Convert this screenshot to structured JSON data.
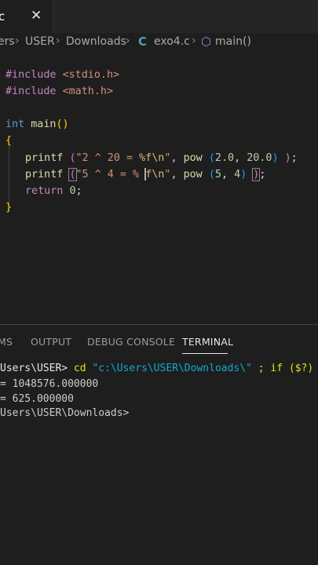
{
  "tab": {
    "label": "c",
    "close": "✕"
  },
  "breadcrumb": {
    "items": [
      "ers",
      "USER",
      "Downloads",
      "exo4.c",
      "main()"
    ],
    "sep": "›"
  },
  "code": {
    "l1": {
      "directive": "#include",
      "header": "<stdio.h>"
    },
    "l2": {
      "directive": "#include",
      "header": "<math.h>"
    },
    "l4": {
      "type": "int",
      "name": "main",
      "parens": "()"
    },
    "l5": "{",
    "l6": {
      "fn": "printf",
      "space": " ",
      "open": "(",
      "str1": "\"2 ^ 20 = ",
      "fmt": "%f",
      "esc": "\\n",
      "str2": "\"",
      "comma": ", ",
      "call": "pow",
      "sp2": " ",
      "open2": "(",
      "a": "2.0",
      "c2": ", ",
      "b": "20.0",
      "close2": ")",
      "sp3": " ",
      "close": ")",
      "semi": ";"
    },
    "l7": {
      "fn": "printf",
      "space": " ",
      "open": "(",
      "str1": "\"5 ^ 4 = % ",
      "fmt": "f",
      "esc": "\\n",
      "str2": "\"",
      "comma": ", ",
      "call": "pow",
      "sp2": " ",
      "open2": "(",
      "a": "5",
      "c2": ", ",
      "b": "4",
      "close2": ")",
      "sp3": " ",
      "close": ")",
      "semi": ";"
    },
    "l8": {
      "kw": "return",
      "val": "0",
      "semi": ";"
    },
    "l9": "}"
  },
  "panel": {
    "tabs": [
      "MS",
      "OUTPUT",
      "DEBUG CONSOLE",
      "TERMINAL"
    ],
    "active": "TERMINAL"
  },
  "terminal": {
    "line1": {
      "prompt": "Users\\USER> ",
      "cmd": "cd",
      "arg": " \"c:\\Users\\USER\\Downloads\\\"",
      "rest": " ; if ($?) {"
    },
    "line2": "= 1048576.000000",
    "line3": "= 625.000000",
    "line4": "Users\\USER\\Downloads>"
  }
}
